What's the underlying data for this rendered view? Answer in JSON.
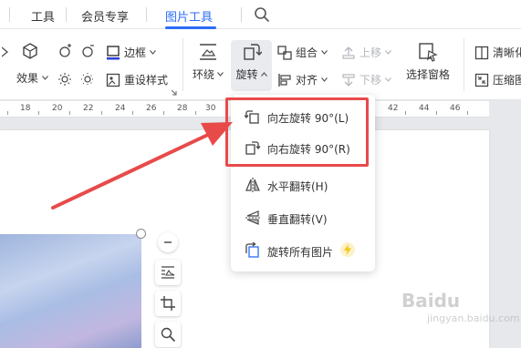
{
  "menubar": {
    "items": [
      {
        "label": "工具"
      },
      {
        "label": "会员专享"
      },
      {
        "label": "图片工具"
      }
    ]
  },
  "ribbon": {
    "border_label": "边框",
    "effects_label": "效果",
    "reset_style_label": "重设样式",
    "wrap_label": "环绕",
    "rotate_label": "旋转",
    "group_label": "组合",
    "align_label": "对齐",
    "move_up_label": "上移",
    "move_down_label": "下移",
    "selection_pane_label": "选择窗格",
    "clear_label": "清晰化",
    "compress_label": "压缩图"
  },
  "ruler": {
    "labels": [
      "18",
      "20",
      "22",
      "24",
      "26",
      "28",
      "30",
      "42",
      "44",
      "46"
    ]
  },
  "rotate_menu": {
    "items": [
      {
        "label": "向左旋转 90°(L)"
      },
      {
        "label": "向右旋转 90°(R)"
      },
      {
        "label": "水平翻转(H)"
      },
      {
        "label": "垂直翻转(V)"
      },
      {
        "label": "旋转所有图片"
      }
    ]
  },
  "watermark": {
    "text": "Baidu",
    "sub": "jingyan.baidu.com"
  },
  "colors": {
    "accent": "#2b6cf6",
    "highlight": "#e84a4a",
    "vip": "#f5c518"
  }
}
